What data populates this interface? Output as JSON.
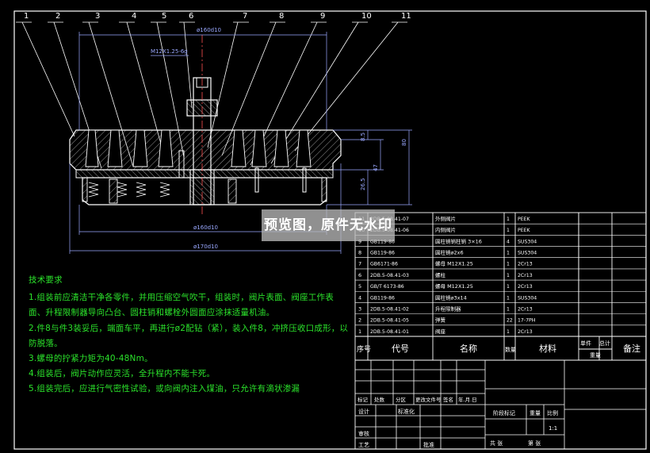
{
  "balloons": [
    "1",
    "2",
    "3",
    "4",
    "5",
    "6",
    "7",
    "8",
    "9",
    "10",
    "11"
  ],
  "dimensions": {
    "d160_top": "ø160d10",
    "thread_m12": "M12X1.25-6g",
    "d160_bottom": "ø160d10",
    "d170": "ø170d10",
    "h8_5": "8.5",
    "h47": "47",
    "h80": "80",
    "h26_5": "26.5"
  },
  "tech_requirements": {
    "title": "技术要求",
    "items": [
      "1.组装前应清洁干净各零件，并用压缩空气吹干，组装时，阀片表面、阀座工作表面、升程限制器导向凸台、圆柱销和螺栓外圆面应涂抹适量机油。",
      "2.件8与件3装妥后，端面车平，再进行ø2配钻（紧），装入件8，冲挤压收口成形，以防脱落。",
      "3.螺母的拧紧力矩为40-48Nm。",
      "4.组装后，阀片动作应灵活，全升程内不能卡死。",
      "5.组装完后，应进行气密性试验，或向阀内注入煤油，只允许有滴状渗漏"
    ]
  },
  "watermark": "预览图，原件无水印",
  "parts_list": {
    "rows": [
      {
        "no": "11",
        "code": "2DB.5-08.41-07",
        "name": "外侧阀片",
        "qty": "1",
        "material": "PEEK"
      },
      {
        "no": "10",
        "code": "2DB.5-08.41-06",
        "name": "内侧阀片",
        "qty": "1",
        "material": "PEEK"
      },
      {
        "no": "9",
        "code": "GB119-86",
        "name": "圆柱销销柱销 3×16",
        "qty": "4",
        "material": "SUS304"
      },
      {
        "no": "8",
        "code": "GB119-86",
        "name": "圆柱销ø2x6",
        "qty": "1",
        "material": "SUS304"
      },
      {
        "no": "7",
        "code": "GB6171-86",
        "name": "螺母 M12X1.25",
        "qty": "1",
        "material": "2Cr13"
      },
      {
        "no": "6",
        "code": "2DB.5-08.41-03",
        "name": "螺柱",
        "qty": "1",
        "material": "2Cr13"
      },
      {
        "no": "5",
        "code": "GB/T 6173-86",
        "name": "螺母 M12X1.25",
        "qty": "1",
        "material": "2Cr13"
      },
      {
        "no": "4",
        "code": "GB119-86",
        "name": "圆柱销ø3x14",
        "qty": "1",
        "material": "SUS304"
      },
      {
        "no": "3",
        "code": "2DB.5-08.41-02",
        "name": "升程限制器",
        "qty": "1",
        "material": "2Cr13"
      },
      {
        "no": "2",
        "code": "2DB.5-08.41-05",
        "name": "弹簧",
        "qty": "22",
        "material": "17-7PH"
      },
      {
        "no": "1",
        "code": "2DB.5-08.41-01",
        "name": "阀座",
        "qty": "1",
        "material": "2Cr13"
      }
    ],
    "header": {
      "no": "序号",
      "code": "代号",
      "name": "名称",
      "qty": "数量",
      "material": "材料",
      "single": "单件",
      "total": "总计",
      "weight": "重量",
      "remark": "备注"
    }
  },
  "title_block": {
    "marks": [
      "标记",
      "处数",
      "分区",
      "更改文件号",
      "签名",
      "年.月.日"
    ],
    "design": "设计",
    "standard": "标准化",
    "review": "审核",
    "process": "工艺",
    "approve": "批准",
    "stage_mark": "阶段标记",
    "weight": "重量",
    "scale": "比例",
    "sheet_total": "共   张",
    "sheet_no": "第   张",
    "scale_mark": "1:1"
  },
  "colors": {
    "outline": "#ffffff",
    "text_green": "#2be32b",
    "leader": "#ffffff",
    "dimension": "#9aa8ff",
    "hatch": "#ffffff"
  }
}
